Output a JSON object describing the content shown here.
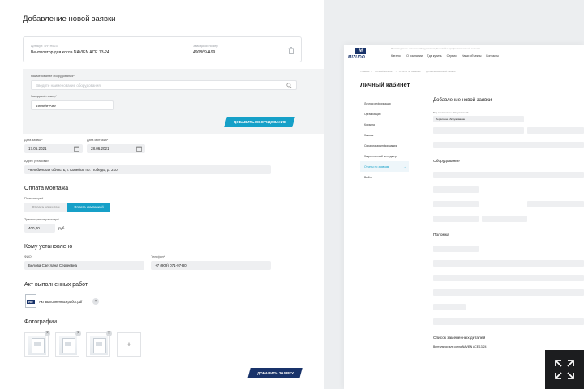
{
  "left": {
    "title": "Добавление новой заявки",
    "product": {
      "article_label": "Артикул: 4RYH523",
      "name": "Вентилятор для котла NAVIEN ACE 13-24",
      "serial_label": "Заводской номер",
      "serial_value": "4908б9-А99"
    },
    "equipment": {
      "name_label": "Наименование оборудования*",
      "name_placeholder": "Введите наименование оборудования",
      "serial_label": "Заводской номер*",
      "serial_value": "4908б9-А99",
      "add_button": "ДОБАВИТЬ ОБОРУДОВАНИЕ"
    },
    "dates": {
      "request_label": "Дата заявки*",
      "request_value": "17.06.2021",
      "install_label": "Дата монтажа*",
      "install_value": "28.06.2021"
    },
    "address": {
      "label": "Адрес установки*",
      "value": "Челябинская область, г. Копейск, пр. Победы, д. 210"
    },
    "payment": {
      "title": "Оплата монтажа",
      "payer_label": "Плательщик*",
      "option_client": "Оплата клиентом",
      "option_company": "Оплата компанией",
      "transport_label": "Транспортные расходы*",
      "transport_value": "400,00",
      "currency": "руб."
    },
    "installed_for": {
      "title": "Кому установлено",
      "fio_label": "ФИО*",
      "fio_value": "Белова Светлана Сергеевна",
      "phone_label": "Телефон*",
      "phone_value": "+7 (909) 071-97-80"
    },
    "act": {
      "title": "Акт выполненных работ",
      "file_type": "PDF",
      "file_name": "Акт выполненных работ.pdf"
    },
    "photos": {
      "title": "Фотографии",
      "add": "+"
    },
    "submit": "ДОБАВИТЬ ЗАЯВКУ"
  },
  "right": {
    "logo_mark": "M",
    "logo_text": "MIZUDO",
    "tagline": "Производитель газового оборудования, бытовой и профессиональной техники",
    "nav": [
      "Каталог",
      "О компании",
      "Где купить",
      "Сервис",
      "Наши объекты",
      "Контакты"
    ],
    "breadcrumbs": [
      "Главная",
      "Личный кабинет",
      "Отчеты по заявкам",
      "Добавление новой заявки"
    ],
    "title": "Личный кабинет",
    "menu": [
      "Личная информация",
      "Организация",
      "Корзина",
      "Заказы",
      "Справочная информация",
      "Закрепленный менеджер",
      "Отчеты по заявкам",
      "Выйти"
    ],
    "menu_active_index": 6,
    "form_title": "Добавление новой заявки",
    "type_label": "Вид технического обслуживания*",
    "type_value": "Первичное обслуживание",
    "sections": [
      "Оборудование",
      "Поломка",
      "Список замененных деталей"
    ],
    "replaced_item": "Вентилятор для котла NAVIEN ACE 13-24"
  }
}
